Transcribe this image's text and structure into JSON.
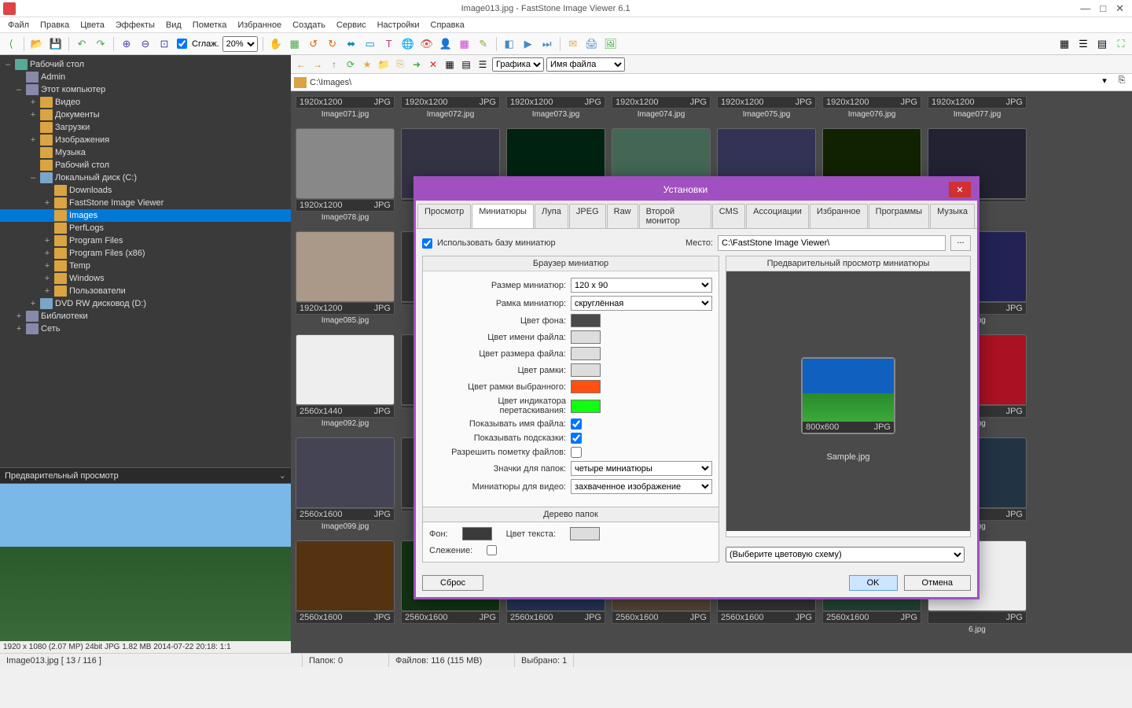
{
  "title": "Image013.jpg  -  FastStone Image Viewer 6.1",
  "menu": [
    "Файл",
    "Правка",
    "Цвета",
    "Эффекты",
    "Вид",
    "Пометка",
    "Избранное",
    "Создать",
    "Сервис",
    "Настройки",
    "Справка"
  ],
  "toolbar": {
    "smooth": "Сглаж.",
    "zoom": "20%"
  },
  "nav": {
    "group": "Графика",
    "sort": "Имя файла"
  },
  "path": "C:\\Images\\",
  "tree": {
    "desktop": "Рабочий стол",
    "admin": "Admin",
    "thispc": "Этот компьютер",
    "video": "Видео",
    "docs": "Документы",
    "downloads_u": "Загрузки",
    "pictures": "Изображения",
    "music": "Музыка",
    "desk2": "Рабочий стол",
    "cdrive": "Локальный диск (C:)",
    "dl": "Downloads",
    "fsiv": "FastStone Image Viewer",
    "images": "Images",
    "perflogs": "PerfLogs",
    "pf": "Program Files",
    "pf86": "Program Files (x86)",
    "temp": "Temp",
    "windows": "Windows",
    "users": "Пользователи",
    "dvd": "DVD RW дисковод (D:)",
    "libs": "Библиотеки",
    "net": "Сеть"
  },
  "previewHdr": "Предварительный просмотр",
  "info": "1920 x 1080 (2.07 MP)   24bit   JPG   1.82 MB    2014-07-22 20:18:  1:1",
  "status": {
    "file": "Image013.jpg [ 13 / 116 ]",
    "folders": "Папок: 0",
    "files": "Файлов: 116 (115 MB)",
    "sel": "Выбрано: 1"
  },
  "thumbs_headrow": [
    {
      "dim": "1920x1200",
      "fmt": "JPG",
      "name": "Image071.jpg"
    },
    {
      "dim": "1920x1200",
      "fmt": "JPG",
      "name": "Image072.jpg"
    },
    {
      "dim": "1920x1200",
      "fmt": "JPG",
      "name": "Image073.jpg"
    },
    {
      "dim": "1920x1200",
      "fmt": "JPG",
      "name": "Image074.jpg"
    },
    {
      "dim": "1920x1200",
      "fmt": "JPG",
      "name": "Image075.jpg"
    },
    {
      "dim": "1920x1200",
      "fmt": "JPG",
      "name": "Image076.jpg"
    },
    {
      "dim": "1920x1200",
      "fmt": "JPG",
      "name": "Image077.jpg"
    }
  ],
  "thumbs": [
    {
      "dim": "1920x1200",
      "fmt": "JPG",
      "name": "Image078.jpg",
      "bg": "#888"
    },
    {
      "dim": "",
      "fmt": "",
      "name": "",
      "bg": "#334"
    },
    {
      "dim": "",
      "fmt": "",
      "name": "",
      "bg": "#021"
    },
    {
      "dim": "",
      "fmt": "",
      "name": "",
      "bg": "#465"
    },
    {
      "dim": "",
      "fmt": "",
      "name": "",
      "bg": "#335"
    },
    {
      "dim": "",
      "fmt": "",
      "name": "",
      "bg": "#120"
    },
    {
      "dim": "",
      "fmt": "",
      "name": "",
      "bg": "#223"
    },
    {
      "dim": "1920x1200",
      "fmt": "JPG",
      "name": "Image085.jpg",
      "bg": "#a98"
    },
    {
      "dim": "",
      "fmt": "",
      "name": "",
      "bg": ""
    },
    {
      "dim": "",
      "fmt": "",
      "name": "",
      "bg": ""
    },
    {
      "dim": "",
      "fmt": "",
      "name": "",
      "bg": ""
    },
    {
      "dim": "",
      "fmt": "",
      "name": "",
      "bg": ""
    },
    {
      "dim": "",
      "fmt": "",
      "name": "",
      "bg": ""
    },
    {
      "dim": "",
      "fmt": "JPG",
      "name": "4.jpg",
      "bg": "#225"
    },
    {
      "dim": "2560x1440",
      "fmt": "JPG",
      "name": "Image092.jpg",
      "bg": "#eee"
    },
    {
      "dim": "",
      "fmt": "",
      "name": "",
      "bg": ""
    },
    {
      "dim": "",
      "fmt": "",
      "name": "",
      "bg": ""
    },
    {
      "dim": "",
      "fmt": "",
      "name": "",
      "bg": ""
    },
    {
      "dim": "",
      "fmt": "",
      "name": "",
      "bg": ""
    },
    {
      "dim": "",
      "fmt": "",
      "name": "",
      "bg": ""
    },
    {
      "dim": "",
      "fmt": "JPG",
      "name": "1.jpg",
      "bg": "#a12"
    },
    {
      "dim": "2560x1600",
      "fmt": "JPG",
      "name": "Image099.jpg",
      "bg": "#445"
    },
    {
      "dim": "",
      "fmt": "",
      "name": "",
      "bg": ""
    },
    {
      "dim": "",
      "fmt": "",
      "name": "",
      "bg": ""
    },
    {
      "dim": "",
      "fmt": "",
      "name": "",
      "bg": ""
    },
    {
      "dim": "",
      "fmt": "",
      "name": "",
      "bg": ""
    },
    {
      "dim": "",
      "fmt": "",
      "name": "",
      "bg": ""
    },
    {
      "dim": "",
      "fmt": "JPG",
      "name": "8.jpg",
      "bg": "#234"
    },
    {
      "dim": "2560x1600",
      "fmt": "JPG",
      "name": "",
      "bg": "#531"
    },
    {
      "dim": "2560x1600",
      "fmt": "JPG",
      "name": "",
      "bg": "#131"
    },
    {
      "dim": "2560x1600",
      "fmt": "JPG",
      "name": "",
      "bg": "#235"
    },
    {
      "dim": "2560x1600",
      "fmt": "JPG",
      "name": "",
      "bg": "#543"
    },
    {
      "dim": "2560x1600",
      "fmt": "JPG",
      "name": "",
      "bg": "#333"
    },
    {
      "dim": "2560x1600",
      "fmt": "JPG",
      "name": "",
      "bg": "#243"
    },
    {
      "dim": "",
      "fmt": "JPG",
      "name": "6.jpg",
      "bg": "#eee"
    }
  ],
  "dialog": {
    "title": "Установки",
    "tabs": [
      "Просмотр",
      "Миниатюры",
      "Лупа",
      "JPEG",
      "Raw",
      "Второй монитор",
      "CMS",
      "Ассоциации",
      "Избранное",
      "Программы",
      "Музыка"
    ],
    "activeTab": 1,
    "useDb": "Использовать базу миниатюр",
    "placeLbl": "Место:",
    "placeVal": "C:\\FastStone Image Viewer\\",
    "browser": "Браузер миниатюр",
    "preview": "Предварительный просмотр миниатюры",
    "labels": {
      "size": "Размер миниатюр:",
      "frame": "Рамка миниатюр:",
      "bg": "Цвет фона:",
      "fname": "Цвет имени файла:",
      "fsize": "Цвет размера файла:",
      "border": "Цвет рамки:",
      "selborder": "Цвет рамки выбранного:",
      "drag": "Цвет индикатора перетаскивания:",
      "showname": "Показывать имя файла:",
      "hints": "Показывать подсказки:",
      "marking": "Разрешить пометку файлов:",
      "foldericon": "Значки для папок:",
      "videothumb": "Миниатюры для видео:"
    },
    "sizeVal": "120 x 90",
    "frameVal": "скруглённая",
    "folderVal": "четыре миниатюры",
    "videoVal": "захваченное изображение",
    "colors": {
      "bg": "#4a4a4a",
      "fname": "#dddddd",
      "fsize": "#dddddd",
      "border": "#dddddd",
      "selborder": "#ff5010",
      "drag": "#10ff10"
    },
    "treeSection": "Дерево папок",
    "treeLabels": {
      "bg": "Фон:",
      "text": "Цвет текста:",
      "track": "Слежение:"
    },
    "treeColors": {
      "bg": "#3a3a3a",
      "text": "#dddddd"
    },
    "scheme": "(Выберите цветовую схему)",
    "sample": {
      "dim": "800x600",
      "fmt": "JPG",
      "name": "Sample.jpg"
    },
    "btns": {
      "reset": "Сброс",
      "ok": "OK",
      "cancel": "Отмена"
    }
  }
}
